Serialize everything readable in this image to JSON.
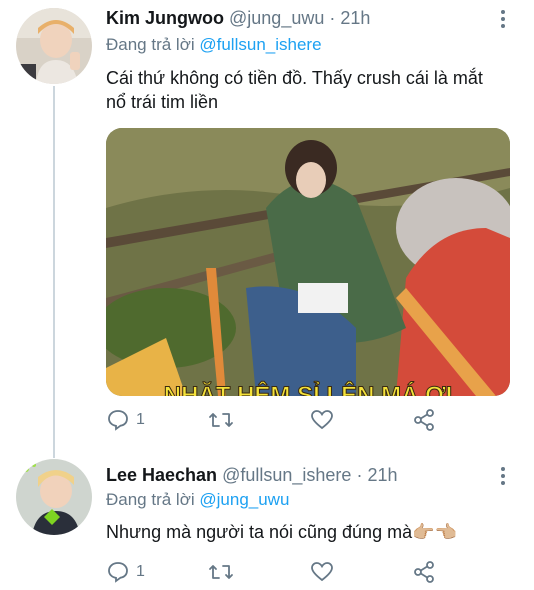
{
  "tweet1": {
    "name": "Kim Jungwoo",
    "handle": "@jung_uwu",
    "dot": "·",
    "time": "21h",
    "reply_prefix": "Đang trả lời",
    "reply_to": "@fullsun_ishere",
    "text_line1": "Cái thứ không có tiền đồ. Thấy crush cái là mắt",
    "text_line2": "nổ trái tim liền",
    "media_caption": "NHẶT HÊM SỈ LÊN MÁ ƠI",
    "reply_count": "1"
  },
  "tweet2": {
    "name": "Lee Haechan",
    "handle": "@fullsun_ishere",
    "dot": "·",
    "time": "21h",
    "reply_prefix": "Đang trả lời",
    "reply_to": "@jung_uwu",
    "text": "Nhưng mà người ta nói cũng đúng mà",
    "emoji": "👉🏼👈🏼",
    "reply_count": "1"
  },
  "colors": {
    "accent": "#1da1f2",
    "muted": "#657786",
    "thread": "#ccd6dd"
  }
}
